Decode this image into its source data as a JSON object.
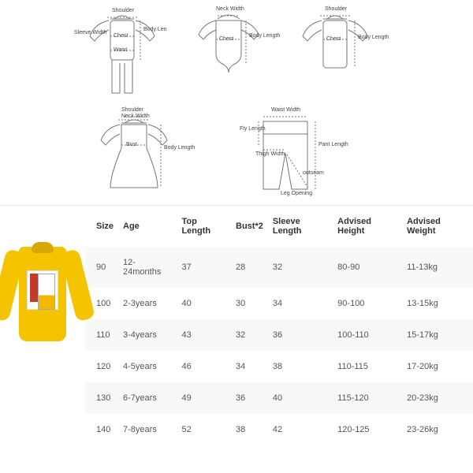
{
  "diagram_labels": {
    "shoulder": "Shoulder",
    "neck_width": "Neck Width",
    "sleeve_width": "Sleeve Width",
    "chest": "Chest",
    "waist": "Waist",
    "body_length_short": "Body\nLen",
    "body_length": "Body\nLength",
    "bust": "Bust",
    "waist_width": "Waist Width",
    "fly_length": "Fly\nLength",
    "thigh_width": "Thigh Width",
    "pant_length": "Pant\nLength",
    "outseam": "outseam",
    "leg_opening": "Leg Opening"
  },
  "chart_data": {
    "type": "table",
    "columns": [
      "Size",
      "Age",
      "Top Length",
      "Bust*2",
      "Sleeve Length",
      "Advised Height",
      "Advised Weight"
    ],
    "rows": [
      {
        "size": "90",
        "age": "12-24months",
        "top_length": "37",
        "bust2": "28",
        "sleeve_length": "32",
        "advised_height": "80-90",
        "advised_weight": "11-13kg"
      },
      {
        "size": "100",
        "age": "2-3years",
        "top_length": "40",
        "bust2": "30",
        "sleeve_length": "34",
        "advised_height": "90-100",
        "advised_weight": "13-15kg"
      },
      {
        "size": "110",
        "age": "3-4years",
        "top_length": "43",
        "bust2": "32",
        "sleeve_length": "36",
        "advised_height": "100-110",
        "advised_weight": "15-17kg"
      },
      {
        "size": "120",
        "age": "4-5years",
        "top_length": "46",
        "bust2": "34",
        "sleeve_length": "38",
        "advised_height": "110-115",
        "advised_weight": "17-20kg"
      },
      {
        "size": "130",
        "age": "6-7years",
        "top_length": "49",
        "bust2": "36",
        "sleeve_length": "40",
        "advised_height": "115-120",
        "advised_weight": "20-23kg"
      },
      {
        "size": "140",
        "age": "7-8years",
        "top_length": "52",
        "bust2": "38",
        "sleeve_length": "42",
        "advised_height": "120-125",
        "advised_weight": "23-26kg"
      }
    ]
  }
}
